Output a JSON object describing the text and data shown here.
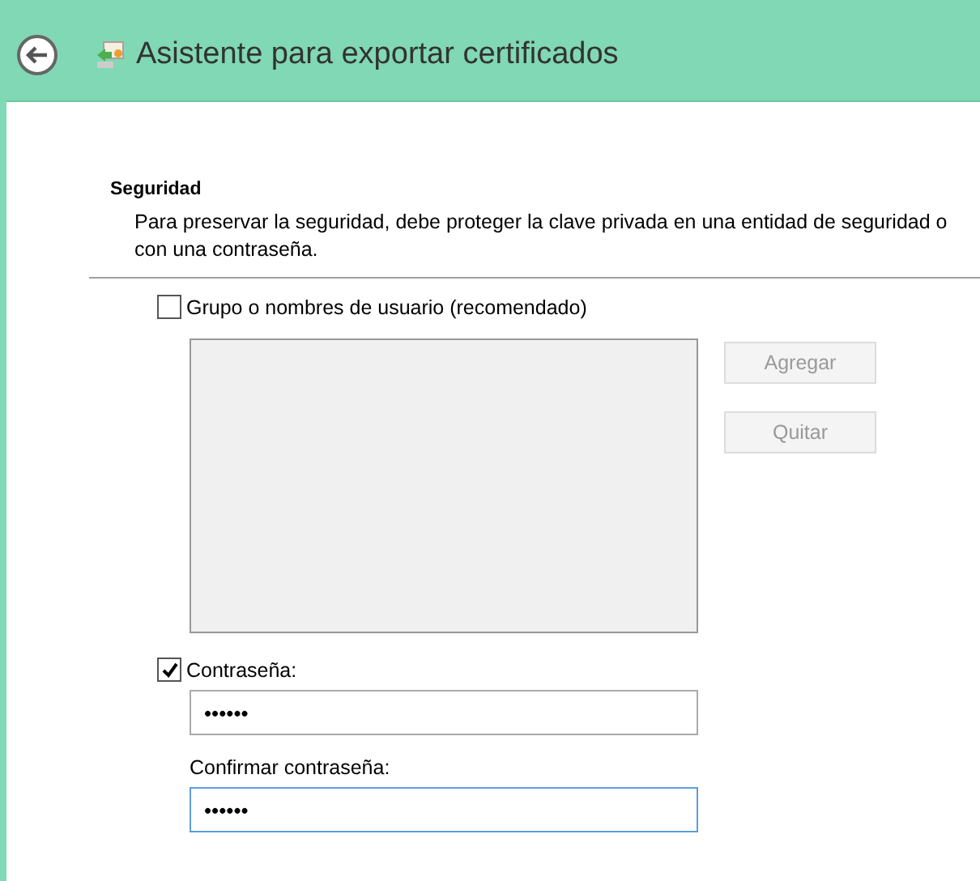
{
  "window": {
    "title": "Asistente para exportar certificados"
  },
  "section": {
    "title": "Seguridad",
    "description": "Para preservar la seguridad, debe proteger la clave privada en una entidad de seguridad o con una contraseña."
  },
  "group_option": {
    "label": "Grupo o nombres de usuario (recomendado)",
    "checked": false
  },
  "buttons": [
    {
      "label": "Agregar",
      "disabled": true
    },
    {
      "label": "Quitar",
      "disabled": true
    }
  ],
  "password_option": {
    "label": "Contraseña:",
    "checked": true
  },
  "password": {
    "value": "••••••",
    "focused": false
  },
  "confirm": {
    "label": "Confirmar contraseña:",
    "value": "••••••",
    "focused": true
  }
}
